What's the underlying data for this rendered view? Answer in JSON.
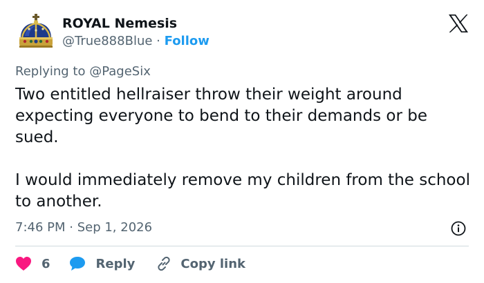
{
  "author": {
    "name": "ROYAL Nemesis",
    "handle": "@True888Blue",
    "separator": "·",
    "follow_label": "Follow"
  },
  "reply_context": {
    "prefix": "Replying to ",
    "mention": "@PageSix"
  },
  "tweet": {
    "paragraph_1": "Two entitled hellraiser throw their weight around expecting everyone to bend to their demands or be sued.",
    "paragraph_2": "I would immediately remove my children from the school to another."
  },
  "meta": {
    "timestamp": "7:46 PM · Sep 1, 2026"
  },
  "actions": {
    "like_count": "6",
    "reply_label": "Reply",
    "copy_link_label": "Copy link"
  },
  "icons": {
    "avatar": "royal-crown-icon",
    "logo": "x-logo-icon",
    "info": "info-icon",
    "like": "heart-icon",
    "reply": "speech-bubble-icon",
    "copy": "link-icon"
  },
  "colors": {
    "like": "#f91880",
    "reply": "#1d9bf0",
    "follow": "#1d9bf0",
    "muted": "#536471",
    "text": "#0f1419"
  }
}
